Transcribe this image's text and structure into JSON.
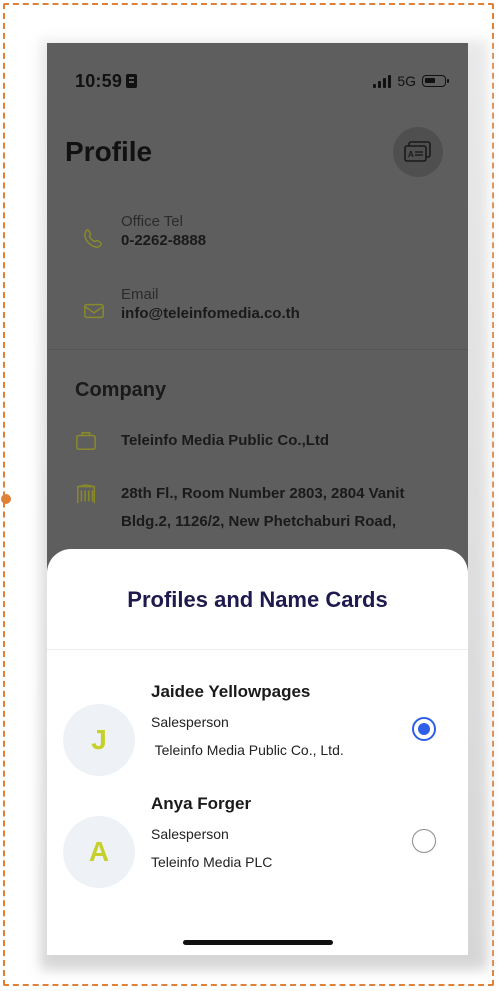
{
  "status": {
    "time": "10:59",
    "network": "5G"
  },
  "profile": {
    "title": "Profile",
    "card_icon": "name-card-icon",
    "office_tel_label": "Office Tel",
    "office_tel_value": "0-2262-8888",
    "email_label": "Email",
    "email_value": "info@teleinfomedia.co.th"
  },
  "company": {
    "heading": "Company",
    "name": "Teleinfo Media Public Co.,Ltd",
    "address_line1": "28th Fl., Room Number 2803, 2804 Vanit",
    "address_line2": "Bldg.2, 1126/2, New Phetchaburi Road,"
  },
  "sheet": {
    "title": "Profiles and Name Cards",
    "profiles": [
      {
        "initial": "J",
        "name": "Jaidee Yellowpages",
        "role": "Salesperson",
        "company": " Teleinfo Media Public Co., Ltd.",
        "selected": true
      },
      {
        "initial": "A",
        "name": "Anya Forger",
        "role": "Salesperson",
        "company": "Teleinfo Media PLC",
        "selected": false
      }
    ]
  },
  "colors": {
    "accent": "#2f5ee8",
    "initial": "#c5d12a",
    "sheet_title": "#1e1a4d",
    "frame": "#e0813a"
  }
}
